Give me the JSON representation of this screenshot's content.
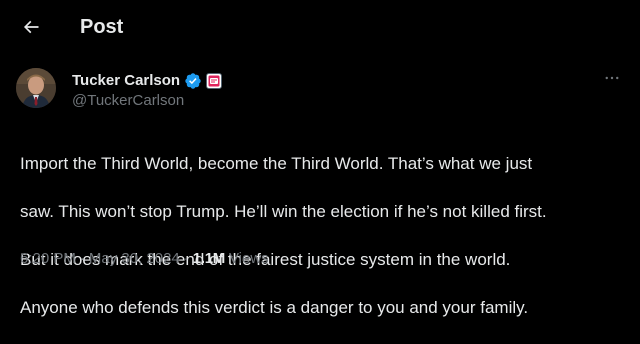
{
  "header": {
    "title": "Post"
  },
  "author": {
    "display_name": "Tucker Carlson",
    "handle": "@TuckerCarlson",
    "verified_color": "#1d9bf0",
    "affiliate_badge_color": "#e0245e"
  },
  "post": {
    "text_lines": [
      "Import the Third World, become the Third World. That’s what we just",
      "saw. This won’t stop Trump. He’ll win the election if he’s not killed first.",
      "But it does mark the end of the fairest justice system in the world.",
      "Anyone who defends this verdict is a danger to you and your family."
    ],
    "time": "6:20 PM",
    "separator": "·",
    "date": "May 30, 2024",
    "views_count": "1.1M",
    "views_label": "Views"
  },
  "theme": {
    "background": "#000000",
    "text_primary": "#e7e9ea",
    "text_secondary": "#71767b"
  }
}
